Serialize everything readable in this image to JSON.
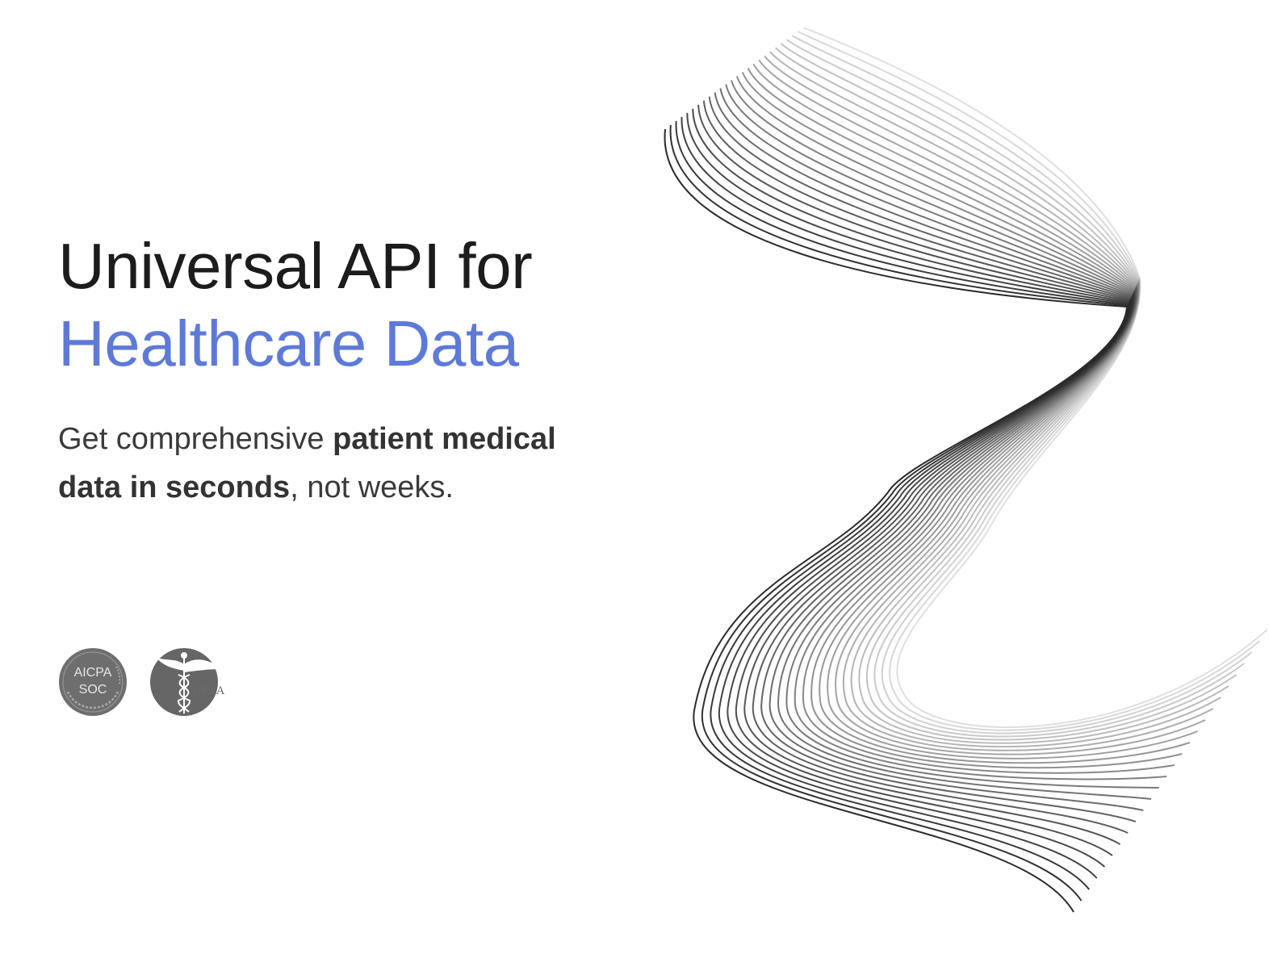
{
  "hero": {
    "title_line1": "Universal API for",
    "title_line2": "Healthcare Data",
    "subtitle_prefix": "Get comprehensive ",
    "subtitle_bold": "patient medical data in seconds",
    "subtitle_suffix": ", not weeks."
  },
  "badges": {
    "soc": {
      "line1": "AICPA",
      "line2": "SOC",
      "icon": "aicpa-soc-badge"
    },
    "hipaa": {
      "label": "HIPAA",
      "icon": "caduceus-icon"
    }
  },
  "colors": {
    "accent": "#5e7ad8",
    "heading": "#1c1c1c",
    "body_text": "#3a3a3a",
    "badge_gray": "#6b6b6b",
    "wave_stroke": "#2b2b2b"
  },
  "decoration": {
    "wave": "flowing-line-wave-graphic"
  }
}
